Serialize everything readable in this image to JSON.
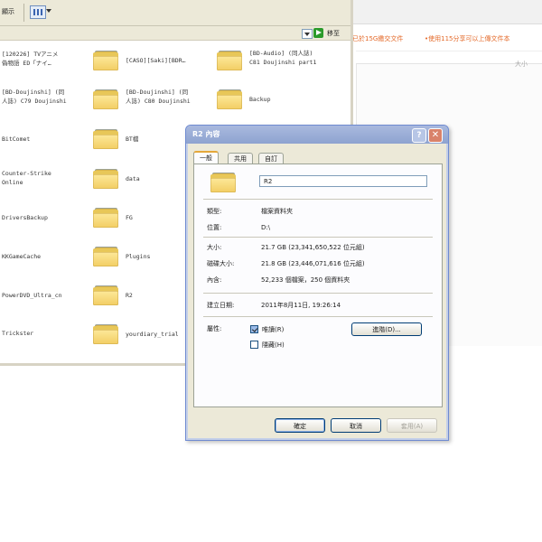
{
  "explorer": {
    "toolbar": {
      "label": "顯示"
    },
    "addressbar": {
      "go_label": "移至"
    },
    "items": [
      {
        "name": "[120226] TVアニメ\n偽物語 ED「ナイ…",
        "has_icon": false
      },
      {
        "name": "[CASO][Saki][BDR…",
        "has_icon": true
      },
      {
        "name": "[BD-Audio] (同人誌)\nC81 Doujinshi part1",
        "has_icon": true
      },
      {
        "name": "[BD-Doujinshi] (同\n人誌) C79 Doujinshi",
        "has_icon": false
      },
      {
        "name": "[BD-Doujinshi] (同\n人誌) C80 Doujinshi",
        "has_icon": true
      },
      {
        "name": "Backup",
        "has_icon": true
      },
      {
        "name": "BitComet",
        "has_icon": false
      },
      {
        "name": "BT檔",
        "has_icon": true
      },
      {
        "name": "Counter-Strike\nOnline",
        "has_icon": false
      },
      {
        "name": "data",
        "has_icon": true
      },
      {
        "name": "DriversBackup",
        "has_icon": false
      },
      {
        "name": "FG",
        "has_icon": true
      },
      {
        "name": "KKGameCache",
        "has_icon": false
      },
      {
        "name": "Plugins",
        "has_icon": true
      },
      {
        "name": "PowerDVD_Ultra_cn",
        "has_icon": false
      },
      {
        "name": "R2",
        "has_icon": true
      },
      {
        "name": "Trickster",
        "has_icon": false
      },
      {
        "name": "yourdiary_trial",
        "has_icon": true
      }
    ]
  },
  "background": {
    "orange_text_1": "已於15G繳交文件",
    "orange_text_2": "•使用115分享可以上傳文件本",
    "gray_text": "大小"
  },
  "dialog": {
    "title": "R2 內容",
    "help": "?",
    "close": "✕",
    "tabs": [
      "一般",
      "共用",
      "自訂"
    ],
    "folder_name": "R2",
    "properties": [
      {
        "label": "類型:",
        "value": "檔案資料夾"
      },
      {
        "label": "位置:",
        "value": "D:\\"
      },
      {
        "label": "大小:",
        "value": "21.7 GB (23,341,650,522 位元組)"
      },
      {
        "label": "磁碟大小:",
        "value": "21.8 GB (23,446,071,616 位元組)"
      },
      {
        "label": "內含:",
        "value": "52,233 個檔案，250 個資料夾"
      }
    ],
    "created": {
      "label": "建立日期:",
      "value": "2011年8月11日, 19:26:14"
    },
    "attributes": {
      "label": "屬性:",
      "readonly": {
        "label": "唯讀(R)",
        "checked": true
      },
      "hidden": {
        "label": "隱藏(H)",
        "checked": false
      },
      "advanced_button": "進階(D)..."
    },
    "buttons": {
      "ok": "確定",
      "cancel": "取消",
      "apply": "套用(A)"
    }
  }
}
